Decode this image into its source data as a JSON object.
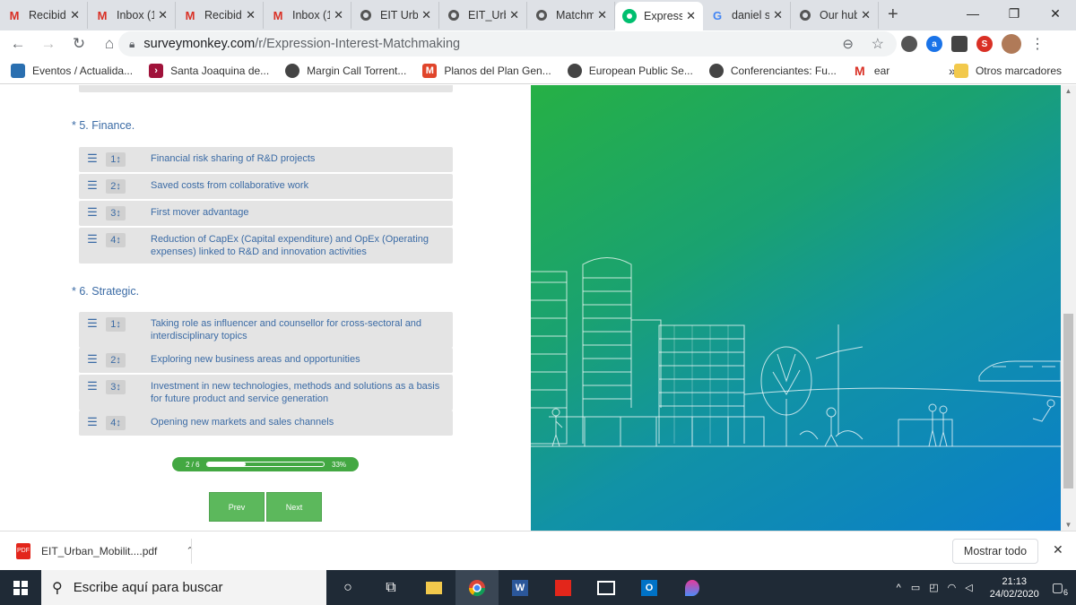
{
  "browser": {
    "tabs": [
      {
        "title": "Recibidos",
        "icon": "gmail-icon"
      },
      {
        "title": "Inbox (1",
        "icon": "gmail-icon"
      },
      {
        "title": "Recibidos",
        "icon": "gmail-icon"
      },
      {
        "title": "Inbox (1",
        "icon": "gmail-icon"
      },
      {
        "title": "EIT Urban",
        "icon": "globe-icon"
      },
      {
        "title": "EIT_Urban",
        "icon": "globe-icon"
      },
      {
        "title": "Matchmaking",
        "icon": "globe-icon"
      },
      {
        "title": "Expression",
        "icon": "surveymonkey-icon",
        "active": true
      },
      {
        "title": "daniel s",
        "icon": "google-icon"
      },
      {
        "title": "Our hub",
        "icon": "globe-icon"
      }
    ],
    "url_domain": "surveymonkey.com",
    "url_path": "/r/Expression-Interest-Matchmaking",
    "bookmarks": [
      "Eventos / Actualida...",
      "Santa Joaquina de...",
      "Margin Call Torrent...",
      "Planos del Plan Gen...",
      "European Public Se...",
      "Conferenciantes: Fu...",
      "ear"
    ],
    "bookmarks_more": "»",
    "other_bookmarks": "Otros marcadores"
  },
  "survey": {
    "q5": {
      "title": "* 5. Finance.",
      "items": [
        {
          "rank": "1",
          "text": "Financial risk sharing of R&D projects"
        },
        {
          "rank": "2",
          "text": "Saved costs from collaborative work"
        },
        {
          "rank": "3",
          "text": "First mover advantage"
        },
        {
          "rank": "4",
          "text": "Reduction of CapEx (Capital expenditure) and OpEx (Operating expenses) linked to R&D and innovation activities"
        }
      ]
    },
    "q6": {
      "title": "* 6. Strategic.",
      "items": [
        {
          "rank": "1",
          "text": "Taking role as influencer and counsellor for cross-sectoral and interdisciplinary topics"
        },
        {
          "rank": "2",
          "text": "Exploring new business areas and opportunities"
        },
        {
          "rank": "3",
          "text": "Investment in new technologies, methods and solutions as a basis for future product and service generation"
        },
        {
          "rank": "4",
          "text": "Opening new markets and sales channels"
        }
      ]
    },
    "progress": {
      "label": "2 / 6",
      "percent_text": "33%",
      "fraction": 0.33
    },
    "prev_label": "Prev",
    "next_label": "Next"
  },
  "downloads": {
    "file_name": "EIT_Urban_Mobilit....pdf",
    "show_all": "Mostrar todo"
  },
  "taskbar": {
    "search_placeholder": "Escribe aquí para buscar",
    "time": "21:13",
    "date": "24/02/2020",
    "notifications": "6"
  },
  "colors": {
    "accent_green": "#43a842",
    "button_green": "#5cb85c",
    "survey_text": "#3b6ba5"
  }
}
